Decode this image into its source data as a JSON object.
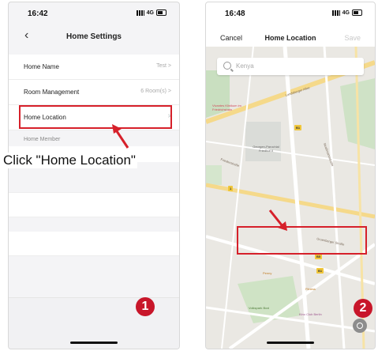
{
  "left": {
    "status": {
      "time": "16:42",
      "network": "4G"
    },
    "nav": {
      "back_icon": "chevron-left-icon",
      "title": "Home Settings"
    },
    "rows": [
      {
        "label": "Home Name",
        "value": "Test >"
      },
      {
        "label": "Room Management",
        "value": "6 Room(s) >"
      },
      {
        "label": "Home Location",
        "value": ">"
      }
    ],
    "member_header": "Home Member",
    "instruction": "Click \"Home Location\"",
    "step_number": "1"
  },
  "right": {
    "status": {
      "time": "16:48",
      "network": "4G"
    },
    "nav": {
      "cancel": "Cancel",
      "title": "Home Location",
      "save": "Save"
    },
    "search": {
      "placeholder": "Kenya"
    },
    "map_labels": {
      "street_1": "Landsberger Allee",
      "hospital": "Vivantes Klinikum im Friedrichshain",
      "cemetery": "Georgen-Parochial Friedhof II",
      "street_2": "Friedenstraße",
      "street_3": "Straßmannstraße",
      "street_4": "Gruenberger Straße",
      "shop_1": "Penny",
      "shop_2": "Fitness",
      "park": "Volkspark Boxi",
      "cinema": "Kino Club Berlin",
      "route_1": "B1",
      "route_2": "1",
      "route_3": "B5",
      "route_4": "B1"
    },
    "step_number": "2",
    "compass_icon": "location-compass-icon"
  },
  "colors": {
    "highlight": "#d6202a",
    "step_badge": "#c8162a"
  }
}
